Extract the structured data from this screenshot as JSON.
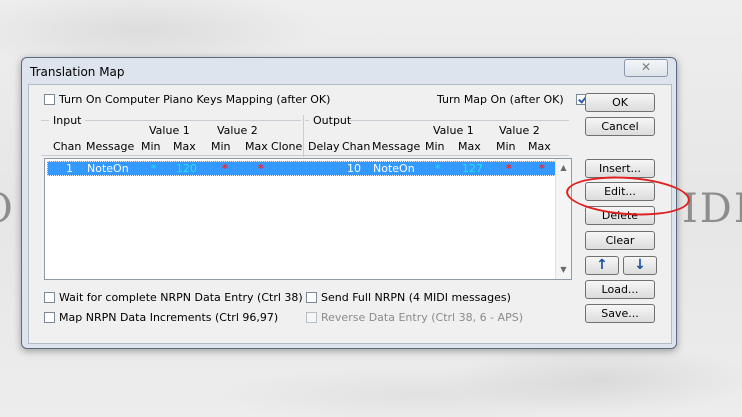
{
  "background": {
    "left_fragment": "O",
    "right_fragment": "IDI"
  },
  "dialog": {
    "title": "Translation Map",
    "close_glyph": "✕",
    "piano_keys_label": "Turn On Computer Piano Keys Mapping (after OK)",
    "piano_keys_checked": false,
    "map_on_label": "Turn Map On (after OK)",
    "map_on_checked": true,
    "input_group": "Input",
    "output_group": "Output",
    "input_headers": {
      "chan": "Chan",
      "message": "Message",
      "value1": "Value 1",
      "value2": "Value 2",
      "min1": "Min",
      "max1": "Max",
      "min2": "Min",
      "max2": "Max",
      "clone": "Clone"
    },
    "output_headers": {
      "delay": "Delay",
      "chan": "Chan",
      "message": "Message",
      "value1": "Value 1",
      "value2": "Value 2",
      "min1": "Min",
      "max1": "Max",
      "min2": "Min",
      "max2": "Max"
    },
    "rows": [
      {
        "in_chan": "1",
        "in_message": "NoteOn",
        "in_v1_min": "*",
        "in_v1_max": "120",
        "in_v2_min": "*",
        "in_v2_max": "*",
        "out_chan": "10",
        "out_message": "NoteOn",
        "out_v1_min": "*",
        "out_v1_max": "127",
        "out_v2_min": "*",
        "out_v2_max": "*"
      }
    ],
    "options": {
      "wait_nrpn": "Wait for complete NRPN Data Entry (Ctrl 38)",
      "map_nrpn": "Map NRPN Data Increments (Ctrl 96,97)",
      "send_full_nrpn": "Send Full NRPN (4 MIDI messages)",
      "reverse_data": "Reverse Data Entry (Ctrl 38, 6 - APS)"
    },
    "buttons": {
      "ok": "OK",
      "cancel": "Cancel",
      "insert": "Insert...",
      "edit": "Edit...",
      "delete": "Delete",
      "clear": "Clear",
      "up": "↑",
      "down": "↓",
      "load": "Load...",
      "save": "Save..."
    },
    "scroll_up": "▲",
    "scroll_down": "▼"
  },
  "colors": {
    "selection": "#3399ff",
    "cyan": "#1de6e6",
    "red": "#ff2020",
    "annotation": "#e02020"
  }
}
